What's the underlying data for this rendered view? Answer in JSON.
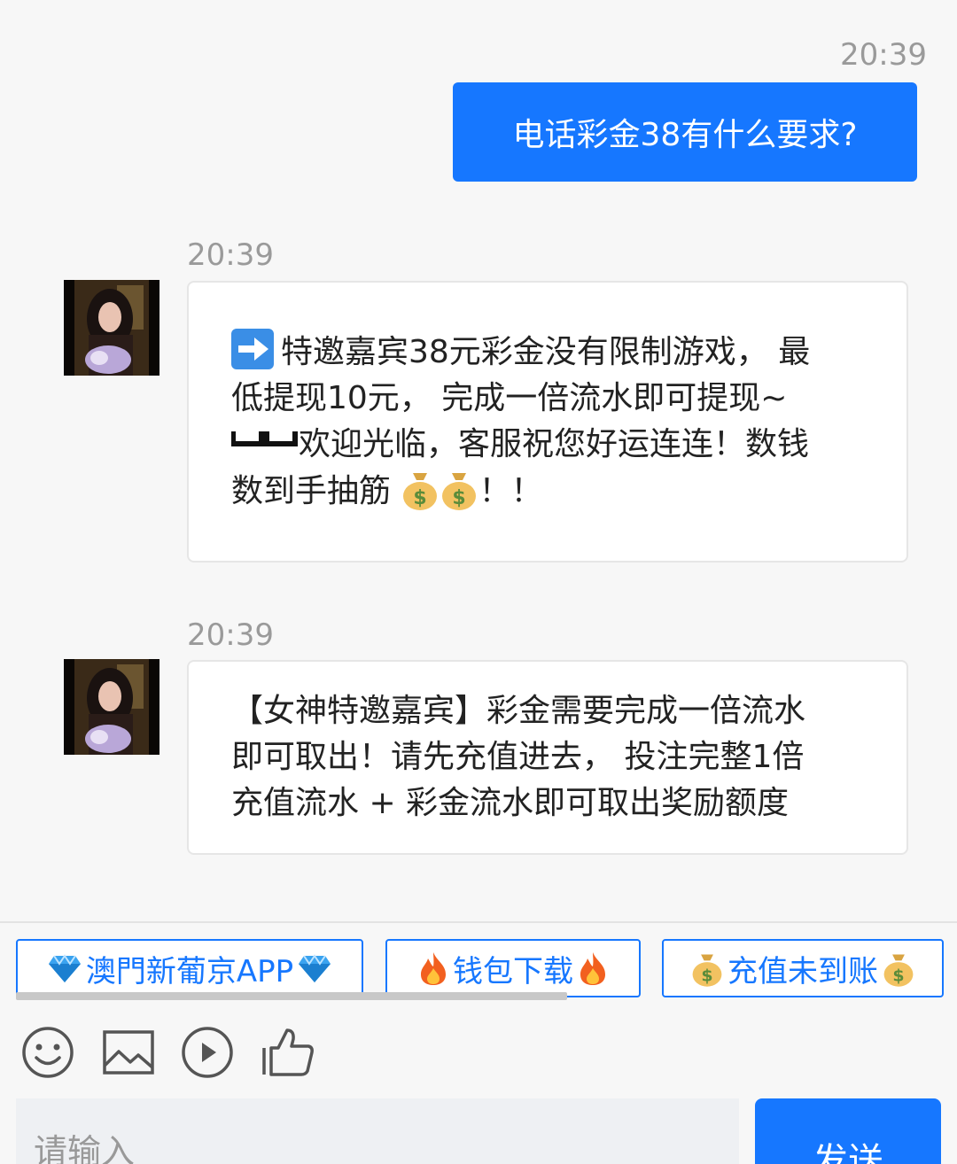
{
  "messages": [
    {
      "side": "out",
      "time": "20:39",
      "text": "电话彩金38有什么要求?"
    },
    {
      "side": "in",
      "time": "20:39",
      "text_a": "特邀嘉宾38元彩金没有限制游戏， 最\n低提现10元， 完成一倍流水即可提现~\n",
      "text_b": "欢迎光临，客服祝您好运连连！数钱\n数到手抽筋 ",
      "text_c": "！！",
      "icons": [
        "right-arrow-icon",
        "continuation-icon",
        "money-bag-icon",
        "money-bag-icon"
      ]
    },
    {
      "side": "in",
      "time": "20:39",
      "text": "【女神特邀嘉宾】彩金需要完成一倍流水\n即可取出！请先充值进去， 投注完整1倍\n充值流水 + 彩金流水即可取出奖励额度"
    }
  ],
  "quick_replies": [
    {
      "label": "澳門新葡京APP",
      "icon": "gem-icon"
    },
    {
      "label": "钱包下载",
      "icon": "fire-icon"
    },
    {
      "label": "充值未到账",
      "icon": "money-bag-icon"
    }
  ],
  "toolbar": [
    "emoji-icon",
    "image-icon",
    "video-icon",
    "thumbs-up-icon"
  ],
  "composer": {
    "placeholder": "请输入",
    "send_label": "发送"
  },
  "colors": {
    "accent": "#1677ff",
    "background": "#f7f7f7",
    "timestamp": "#9a9a9a"
  }
}
